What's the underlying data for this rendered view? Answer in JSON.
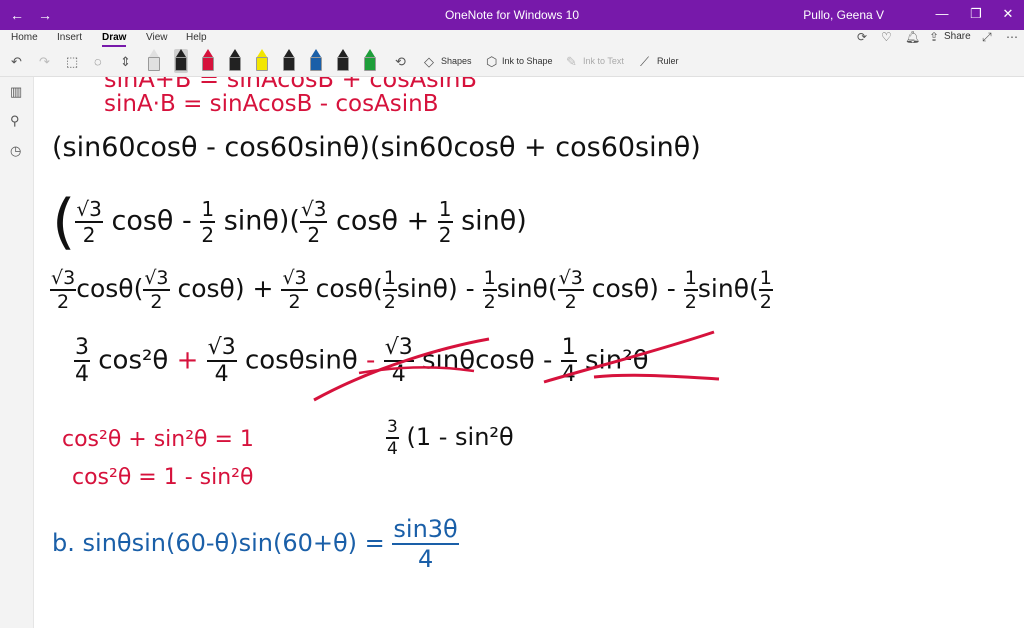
{
  "titlebar": {
    "back": "←",
    "forward": "→",
    "title": "OneNote for Windows 10",
    "user": "Pullo, Geena V",
    "minimize": "—",
    "maximize": "❐",
    "close": "✕"
  },
  "tabs": [
    "Home",
    "Insert",
    "Draw",
    "View",
    "Help"
  ],
  "toolbar": {
    "shapes": "Shapes",
    "ink_to_shape": "Ink to Shape",
    "ink_to_text": "Ink to Text",
    "ruler": "Ruler",
    "share": "Share"
  },
  "pens": [
    {
      "color": "#e0e0e0",
      "selected": false
    },
    {
      "color": "#222222",
      "selected": true
    },
    {
      "color": "#d6123c",
      "selected": false
    },
    {
      "color": "#222222",
      "selected": false
    },
    {
      "color": "#f2e600",
      "selected": false
    },
    {
      "color": "#222222",
      "selected": false
    },
    {
      "color": "#1a5fa8",
      "selected": false
    },
    {
      "color": "#222222",
      "selected": false
    },
    {
      "color": "#1e9e3a",
      "selected": false
    }
  ],
  "notes": {
    "red1": "sinA+B = sinAcosB + cosAsinB",
    "red2": "sinA·B = sinAcosB - cosAsinB",
    "line1": "(sin60cosθ - cos60sinθ)(sin60cosθ + cos60sinθ)",
    "l2_a_num": "√3",
    "l2_a_den": "2",
    "l2_a_tail": "cosθ -",
    "l2_b_num": "1",
    "l2_b_den": "2",
    "l2_b_tail": "sinθ)(",
    "l2_c_num": "√3",
    "l2_c_den": "2",
    "l2_c_tail": "cosθ +",
    "l2_d_num": "1",
    "l2_d_den": "2",
    "l2_d_tail": "sinθ)",
    "l3_a": "cosθ(",
    "l3_b": "cosθ) +",
    "l3_c": "cosθ(",
    "l3_d": "sinθ) -",
    "l3_e": "sinθ(",
    "l3_f": "cosθ) -",
    "l3_g": "sinθ(",
    "l3_h": "1",
    "l3_i": "2",
    "l3_sqrt3": "√3",
    "l3_two": "2",
    "l3_one": "1",
    "l4_a_num": "3",
    "l4_a_den": "4",
    "l4_a_tail": "cos²θ",
    "l4_plus": "+",
    "l4_b_num": "√3",
    "l4_b_den": "4",
    "l4_b_tail": "cosθsinθ",
    "l4_minus": "-",
    "l4_c_num": "√3",
    "l4_c_den": "4",
    "l4_c_tail": "sinθcosθ -",
    "l4_d_num": "1",
    "l4_d_den": "4",
    "l4_d_tail": "sin²θ",
    "red3": "cos²θ + sin²θ = 1",
    "red4": "cos²θ = 1 - sin²θ",
    "step_num": "3",
    "step_den": "4",
    "step_tail": "(1 - sin²θ",
    "b_label": "b.",
    "b_lhs": "sinθsin(60-θ)sin(60+θ) =",
    "b_num": "sin3θ",
    "b_den": "4"
  }
}
